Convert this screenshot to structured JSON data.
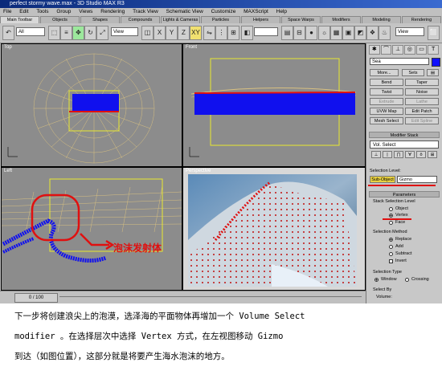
{
  "window": {
    "title": "perfect stormy wave.max - 3D Studio MAX R3"
  },
  "menu": [
    "File",
    "Edit",
    "Tools",
    "Group",
    "Views",
    "Rendering",
    "Track View",
    "Schematic View",
    "Customize",
    "MAXScript",
    "Help"
  ],
  "tabs": [
    {
      "label": "Main Toolbar",
      "active": true
    },
    {
      "label": "Objects"
    },
    {
      "label": "Shapes"
    },
    {
      "label": "Compounds"
    },
    {
      "label": "Lights & Cameras"
    },
    {
      "label": "Particles"
    },
    {
      "label": "Helpers"
    },
    {
      "label": "Space Warps"
    },
    {
      "label": "Modifiers"
    },
    {
      "label": "Modeling"
    },
    {
      "label": "Rendering"
    }
  ],
  "toolbar": {
    "filter": "All",
    "coord": "View",
    "coord2": "View"
  },
  "viewports": {
    "top": "Top",
    "front": "Front",
    "left": "Left",
    "perspective": "Perspective"
  },
  "command_panel": {
    "name": "Sea",
    "buttons": {
      "more": "More...",
      "sets": "Sets",
      "bend": "Bend",
      "taper": "Taper",
      "twist": "Twist",
      "noise": "Noise",
      "extrude": "Extrude",
      "lathe": "Lathe",
      "uvw_map": "UVW Map",
      "edit_patch": "Edit Patch",
      "mesh_select": "Mesh Select",
      "edit_spline": "Edit Spline"
    },
    "modifier_stack_title": "Modifier Stack",
    "stack_value": "Vol. Select",
    "selection_level_label": "Selection Level:",
    "sub_object_label": "Sub-Object",
    "sub_object_value": "Gizmo",
    "parameters_title": "Parameters",
    "stack_sel_level_title": "Stack Selection Level",
    "levels": [
      "Object",
      "Vertex",
      "Face"
    ],
    "selected_level": "Vertex",
    "sel_method_title": "Selection Method",
    "methods": [
      "Replace",
      "Add",
      "Subtract",
      "Invert"
    ],
    "selected_method": "Replace",
    "sel_type_title": "Selection Type",
    "types": [
      "Window",
      "Crossing"
    ],
    "selected_type": "Window",
    "select_by_title": "Select By",
    "select_by_value": "Volume:"
  },
  "status": {
    "frame": "0 / 100"
  },
  "annotation": "泡沫发射体",
  "caption": [
    "下一步将创建浪尖上的泡漠，选泽海的平面物体再增加一个 Volume Select",
    "modifier 。在选择层次中选择 Vertex 方式，在左视图移动 Gizmo",
    "到达（如图位置），这部分就是将要产生海水泡沫的地方。"
  ],
  "colors": {
    "sea_blue": "#1010ee",
    "gizmo": "#e8e830",
    "highlight_red": "#e01010"
  }
}
